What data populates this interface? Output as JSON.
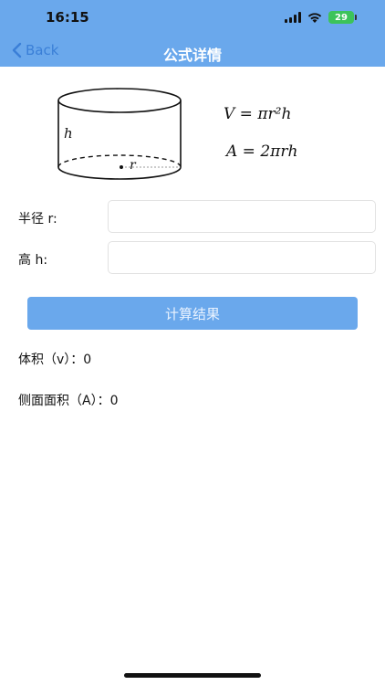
{
  "status_bar": {
    "time": "16:15",
    "battery": "29"
  },
  "nav": {
    "back_label": "Back",
    "title": "公式详情"
  },
  "diagram": {
    "height_label": "h",
    "radius_label": "r"
  },
  "formulas": {
    "volume": "V = πr²h",
    "area": "A = 2πrh"
  },
  "form": {
    "radius_label": "半径 r:",
    "radius_value": "",
    "height_label": "高 h:",
    "height_value": ""
  },
  "calculate_button": "计算结果",
  "results": {
    "volume": "体积（v）：0",
    "lateral_area": "侧面面积（A）：0"
  },
  "colors": {
    "nav_bar": "#6aa8ec",
    "back_link": "#3a7fd7",
    "button": "#6aa8ec",
    "battery": "#3cc35a"
  }
}
